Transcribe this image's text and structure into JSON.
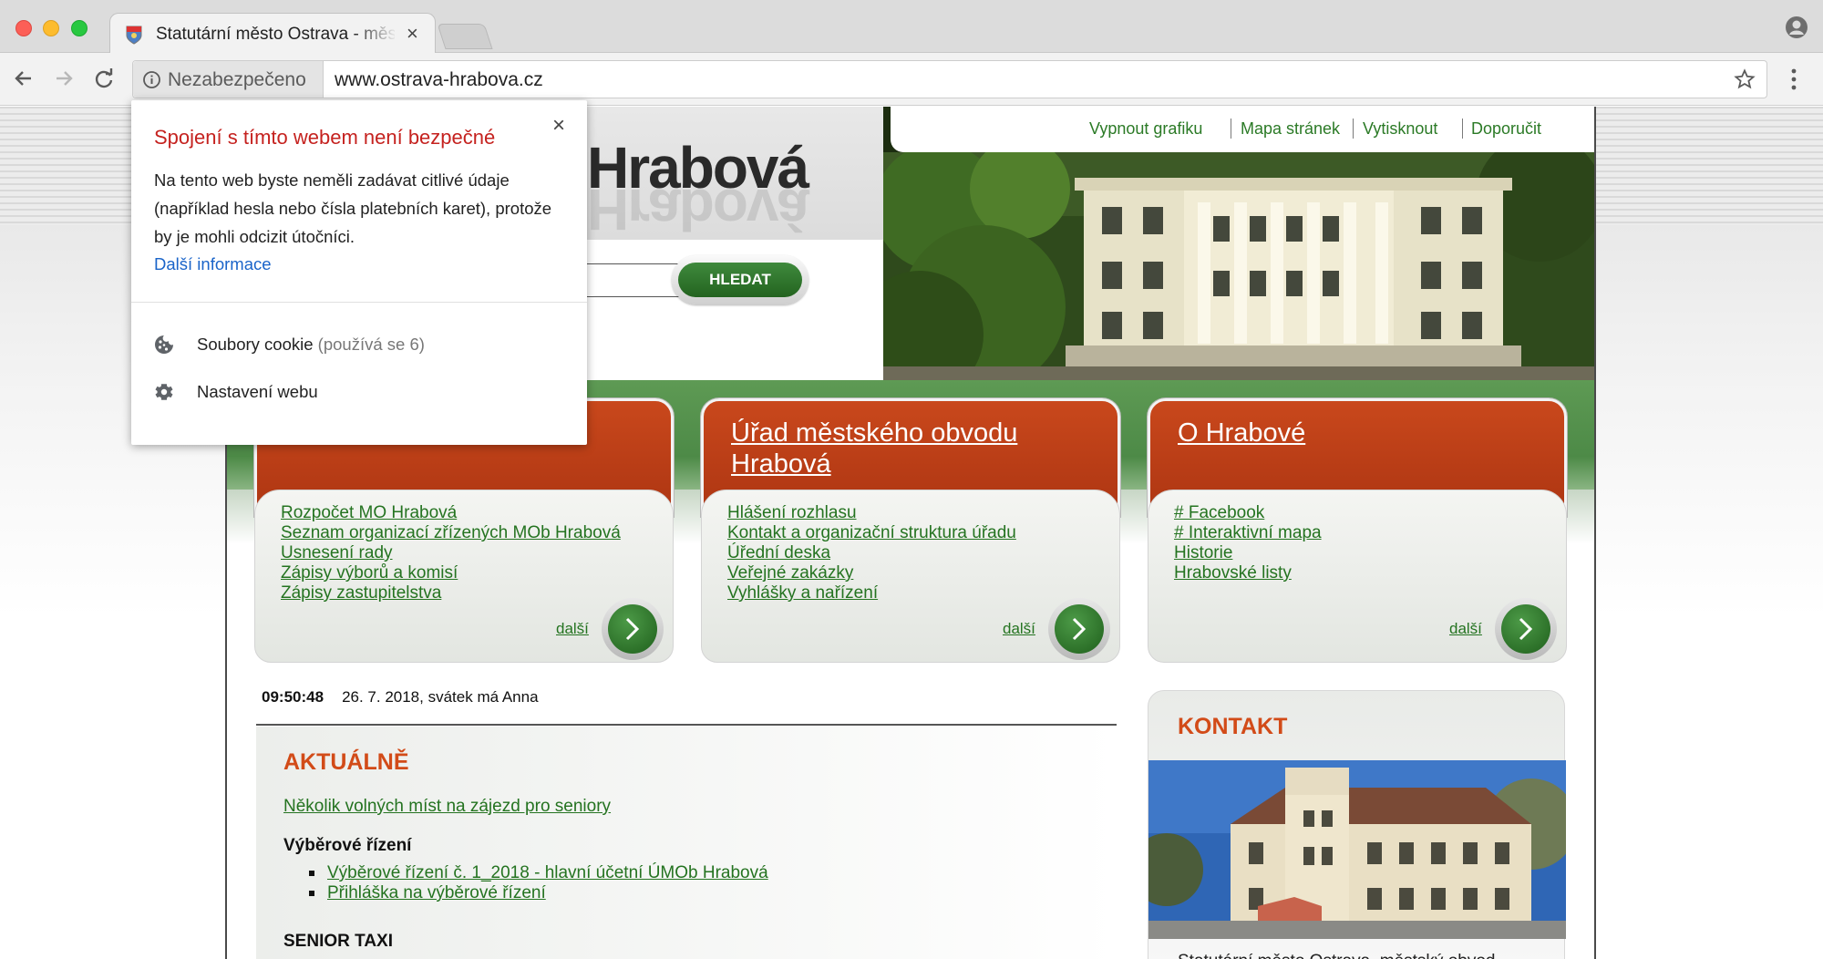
{
  "browser": {
    "tab_title": "Statutární město Ostrava - městský obvod Hrabová",
    "tab_close": "×",
    "security_chip": "Nezabezpečeno",
    "url": "www.ostrava-hrabova.cz",
    "icons": [
      "back-arrow-icon",
      "forward-arrow-icon",
      "reload-icon",
      "info-icon",
      "bookmark-star-icon",
      "menu-dots-icon",
      "profile-icon"
    ]
  },
  "security_popup": {
    "title": "Spojení s tímto webem není bezpečné",
    "body": "Na tento web byste neměli zadávat citlivé údaje (například hesla nebo čísla platebních karet), protože by je mohli odcizit útočníci.",
    "more_link": "Další informace",
    "close": "×",
    "cookies_label": "Soubory cookie",
    "cookies_count": "(používá se 6)",
    "site_settings_label": "Nastavení webu"
  },
  "site": {
    "logo": "Hrabová",
    "search_button": "HLEDAT",
    "topnav": [
      "Vypnout grafiku",
      "Mapa stránek",
      "Vytisknout",
      "Doporučit"
    ],
    "cards": [
      {
        "title": "",
        "links": [
          "Rozpočet MO Hrabová",
          "Seznam organizací zřízených MOb Hrabová",
          "Usnesení rady",
          "Zápisy výborů a komisí",
          "Zápisy zastupitelstva"
        ],
        "more": "další"
      },
      {
        "title": "Úřad městského obvodu Hrabová",
        "links": [
          "Hlášení rozhlasu",
          "Kontakt a organizační struktura úřadu",
          "Úřední deska",
          "Veřejné zakázky",
          "Vyhlášky a nařízení"
        ],
        "more": "další"
      },
      {
        "title": "O Hrabové",
        "links": [
          "# Facebook",
          "# Interaktivní mapa",
          "Historie",
          "Hrabovské listy"
        ],
        "more": "další"
      }
    ],
    "time": "09:50:48",
    "date": "26. 7. 2018, svátek má Anna",
    "news": {
      "heading": "AKTUÁLNĚ",
      "lead_link": "Několik volných míst na zájezd pro seniory",
      "subheading": "Výběrové řízení",
      "items": [
        "Výběrové řízení č. 1_2018 - hlavní účetní ÚMOb Hrabová",
        "Přihláška na výběrové řízení"
      ],
      "subheading2": "SENIOR TAXI"
    },
    "kontakt": {
      "title": "KONTAKT",
      "text": "Statutární město Ostrava, městský obvod"
    }
  }
}
